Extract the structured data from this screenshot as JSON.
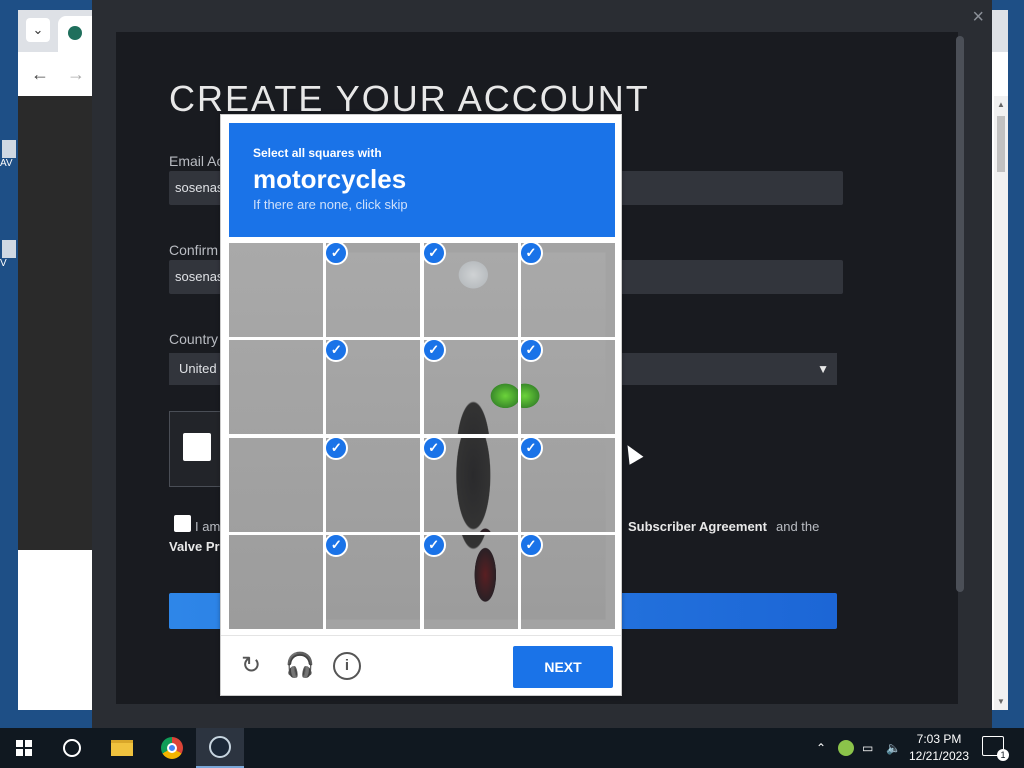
{
  "browser": {
    "tab_dropdown": "⌄",
    "back": "←",
    "forward": "→"
  },
  "desktop_icons": [
    "AV",
    "V"
  ],
  "steam": {
    "close": "×",
    "title": "CREATE YOUR ACCOUNT",
    "email_label": "Email Ac",
    "email_value": "sosenas",
    "confirm_label": "Confirm",
    "confirm_value": "sosenas",
    "country_label": "Country",
    "country_value": "United",
    "agree_text": "I am",
    "subscriber_link": "Subscriber Agreement",
    "and_the": "and the",
    "valve_link": "Valve Pr"
  },
  "recaptcha": {
    "instruction_small": "Select all squares with",
    "target": "motorcycles",
    "hint": "If there are none, click skip",
    "next_label": "NEXT",
    "tiles_selected": [
      [
        false,
        true,
        true,
        true
      ],
      [
        false,
        true,
        true,
        true
      ],
      [
        false,
        true,
        true,
        true
      ],
      [
        false,
        true,
        true,
        true
      ]
    ],
    "check": "✓"
  },
  "taskbar": {
    "time": "7:03 PM",
    "date": "12/21/2023",
    "notification_count": "1"
  },
  "colors": {
    "recaptcha_blue": "#1a73e8",
    "steam_bg": "#191b20",
    "steam_button": "#1c66d6"
  }
}
